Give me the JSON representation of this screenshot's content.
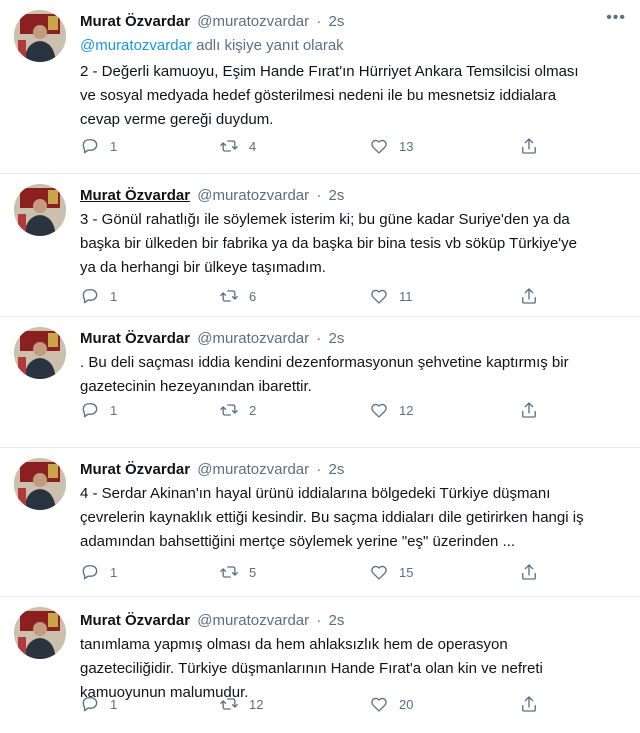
{
  "tweets": [
    {
      "name": "Murat Özvardar",
      "handle": "@muratozvardar",
      "sep": "·",
      "time": "2s",
      "reply_mention": "@muratozvardar",
      "reply_suffix": "adlı kişiye yanıt olarak",
      "lines": [
        "2 - Değerli kamuoyu, Eşim Hande Fırat'ın Hürriyet Ankara Temsilcisi olması",
        "ve sosyal medyada hedef gösterilmesi nedeni ile bu mesnetsiz iddialara",
        "cevap verme gereği duydum."
      ],
      "replies": "1",
      "retweets": "4",
      "likes": "13"
    },
    {
      "name": "Murat Özvardar",
      "handle": "@muratozvardar",
      "sep": "·",
      "time": "2s",
      "lines": [
        "3 - Gönül rahatlığı ile söylemek isterim ki; bu güne kadar  Suriye'den ya da",
        "başka bir ülkeden bir fabrika ya da başka bir bina tesis vb söküp Türkiye'ye",
        "ya da herhangi bir ülkeye taşımadım."
      ],
      "replies": "1",
      "retweets": "6",
      "likes": "11"
    },
    {
      "name": "Murat Özvardar",
      "handle": "@muratozvardar",
      "sep": "·",
      "time": "2s",
      "lines": [
        ".  Bu deli saçması iddia kendini dezenformasyonun şehvetine kaptırmış bir",
        "gazetecinin hezeyanından ibarettir."
      ],
      "replies": "1",
      "retweets": "2",
      "likes": "12"
    },
    {
      "name": "Murat Özvardar",
      "handle": "@muratozvardar",
      "sep": "·",
      "time": "2s",
      "lines": [
        "4 - Serdar Akinan'ın hayal ürünü iddialarına bölgedeki Türkiye düşmanı",
        "çevrelerin kaynaklık ettiği kesindir. Bu saçma iddiaları dile getirirken hangi iş",
        "adamından bahsettiğini mertçe söylemek yerine \"eş\" üzerinden ..."
      ],
      "replies": "1",
      "retweets": "5",
      "likes": "15"
    },
    {
      "name": "Murat Özvardar",
      "handle": "@muratozvardar",
      "sep": "·",
      "time": "2s",
      "lines": [
        "tanımlama yapmış olması da hem ahlaksızlık hem de operasyon",
        "gazeteciliğidir. Türkiye düşmanlarının Hande Fırat'a olan kin ve nefreti",
        "kamuoyunun malumudur."
      ],
      "replies": "1",
      "retweets": "12",
      "likes": "20"
    }
  ],
  "icons": [
    "more-icon",
    "reply-icon",
    "retweet-icon",
    "like-icon",
    "share-icon"
  ],
  "colors": {
    "text": "#0f1419",
    "muted": "#5b7083",
    "link": "#1b95e0",
    "divider": "#e6ecf0"
  }
}
